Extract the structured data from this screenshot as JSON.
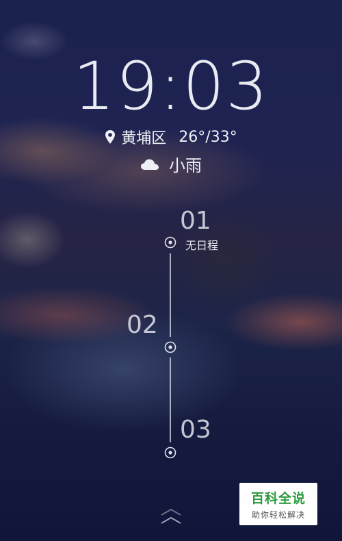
{
  "lockscreen": {
    "time": "19:03",
    "location": "黄埔区",
    "temperature": "26°/33°",
    "weather": "小雨",
    "icons": [
      "location-pin-icon",
      "cloud-icon",
      "timeline-node-icon",
      "swipe-up-chevron-icon"
    ]
  },
  "calendar": {
    "days": [
      {
        "number": "01",
        "schedule": "无日程"
      },
      {
        "number": "02"
      },
      {
        "number": "03"
      }
    ]
  },
  "watermark": {
    "title": "百科全说",
    "subtitle": "助你轻松解决",
    "color": "#2b9a3c"
  }
}
